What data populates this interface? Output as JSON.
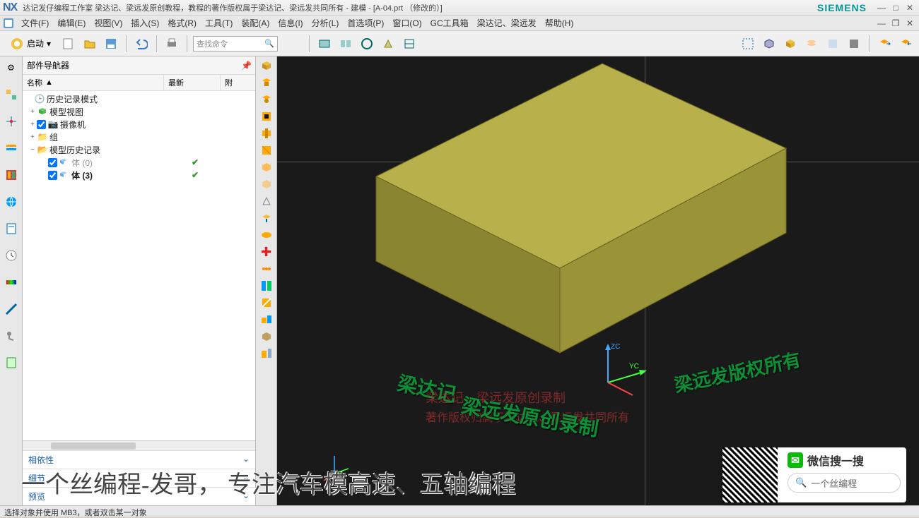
{
  "title_bar": {
    "logo": "NX",
    "title": "达记发仔编程工作室  梁达记、梁远发原创教程，教程的著作版权属于梁达记、梁远发共同所有 - 建模 - [A-04.prt （修改的）]",
    "brand": "SIEMENS"
  },
  "menu": {
    "items": [
      "文件(F)",
      "编辑(E)",
      "视图(V)",
      "插入(S)",
      "格式(R)",
      "工具(T)",
      "装配(A)",
      "信息(I)",
      "分析(L)",
      "首选项(P)",
      "窗口(O)",
      "GC工具箱",
      "梁达记、梁远发",
      "帮助(H)"
    ]
  },
  "toolbar": {
    "start_label": "启动",
    "search_placeholder": "查找命令"
  },
  "navigator": {
    "title": "部件导航器",
    "col_name": "名称",
    "col_latest": "最新",
    "col_r": "附",
    "tree": {
      "history_mode": "历史记录模式",
      "model_view": "模型视图",
      "camera": "摄像机",
      "group": "组",
      "model_history": "模型历史记录",
      "body0": "体 (0)",
      "body3": "体 (3)"
    },
    "footer": {
      "dependency": "相依性",
      "detail": "细节",
      "preview": "预览"
    }
  },
  "viewport": {
    "axis_z": "ZC",
    "axis_y": "YC",
    "watermarks": {
      "w1": "梁达记",
      "w2": "梁远发版权所有",
      "w3": "梁达记、梁远发原创录制",
      "w4": "著作版权归属于梁达记、梁远发共同所有",
      "w5": "梁远发原创录制"
    }
  },
  "caption": "一个丝编程-发哥，    专注汽车模高速、五轴编程",
  "wechat": {
    "title": "微信搜一搜",
    "search": "一个丝编程"
  },
  "status": "选择对象并使用 MB3，或者双击某一对象",
  "chart_data": null
}
